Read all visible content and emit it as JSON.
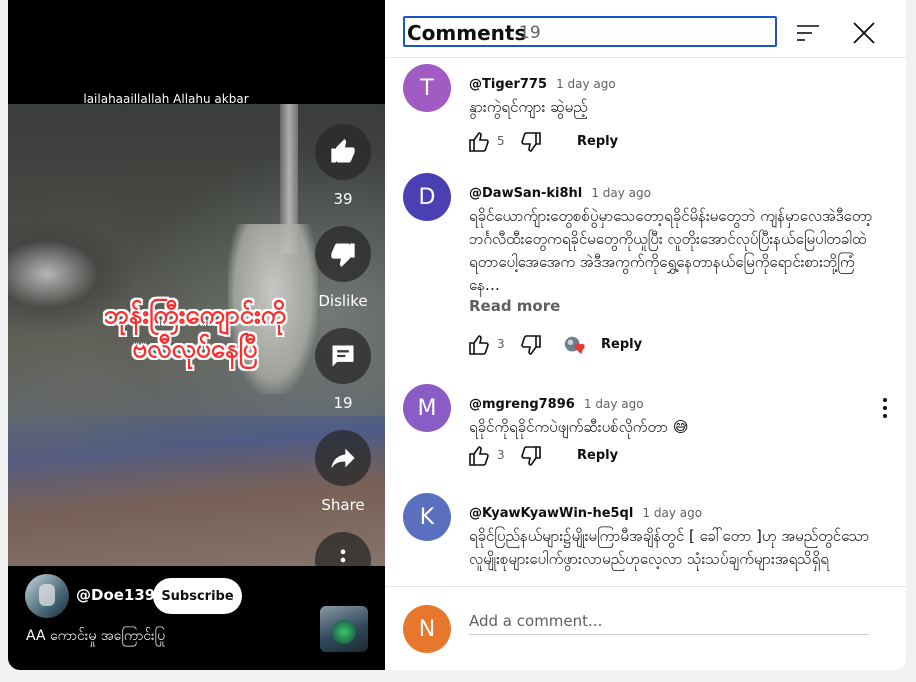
{
  "video": {
    "top_caption": "lailahaaillallah Allahu akbar",
    "overlay_line1": "ဘုန်းကြီးကျောင်းကို",
    "overlay_line2": "ဗလီလုပ်နေပြီ",
    "like_count": "39",
    "dislike_label": "Dislike",
    "comment_count": "19",
    "share_label": "Share",
    "channel_name": "@Doe139",
    "subscribe_label": "Subscribe",
    "title": "AA ကောင်းမှု အကြောင်းပြု"
  },
  "comments_panel": {
    "title": "Comments",
    "count": "19",
    "comments": [
      {
        "avatar_letter": "T",
        "avatar_color": "#a05cc2",
        "author": "@Tiger775",
        "time": "1 day ago",
        "text": "နွားကွဲရင်ကျား ဆွဲမည့်",
        "likes": "5",
        "reply_label": "Reply"
      },
      {
        "avatar_letter": "D",
        "avatar_color": "#4a3fb3",
        "author": "@DawSan-ki8hl",
        "time": "1 day ago",
        "text": "ရခိုင်ယောက်ျားတွေစစ်ပွဲမှာသေတော့ရခိုင်မိန်းမတွေဘဲ ကျန်မှာလေအဲဒီတော့ဘင်္ဂလီထီးတွေကရခိုင်မတွေကိုယူပြီး လူတိုးအောင်လုပ်ပြီးနယ်မြေပါတခါထဲရတာပေါ့အေအေက အဲဒီအကွက်ကိုရွှေ့နေတာနယ်မြေကိုရောင်းစားဘို့ကြံနေ…",
        "read_more": "Read more",
        "likes": "3",
        "reply_label": "Reply"
      },
      {
        "avatar_letter": "M",
        "avatar_color": "#8a5cc6",
        "author": "@mgreng7896",
        "time": "1 day ago",
        "text": "ရခိုင်ကိုရခိုင်ကပဲဖျက်ဆီးပစ်လိုက်တာ 😅",
        "likes": "3",
        "reply_label": "Reply"
      },
      {
        "avatar_letter": "K",
        "avatar_color": "#5b6fbf",
        "author": "@KyawKyawWin-he5ql",
        "time": "1 day ago",
        "text": "ရခိုင်ပြည်နယ်များ၌မျိုးမကြာမီအချိန်တွင် [ ခေါ်တော ]ဟု အမည်တွင်သောလူမျိုးစုများပေါက်ဖွားလာမည်ဟုလေ့လာ သုံးသပ်ချက်များအရသိရှိရ"
      }
    ],
    "add_comment": {
      "avatar_letter": "N",
      "placeholder": "Add a comment..."
    }
  }
}
